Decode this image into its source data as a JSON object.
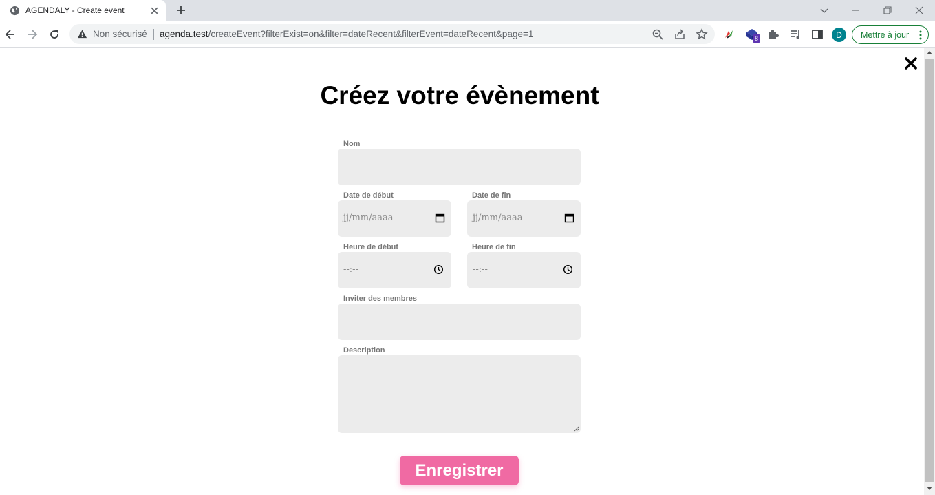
{
  "browser": {
    "tab_title": "AGENDALY - Create event",
    "security_label": "Non sécurisé",
    "url_host": "agenda.test",
    "url_path": "/createEvent?filterExist=on&filter=dateRecent&filterEvent=dateRecent&page=1",
    "extension_badge": "8",
    "profile_initial": "D",
    "update_label": "Mettre à jour"
  },
  "page": {
    "title": "Créez votre évènement",
    "fields": {
      "name": {
        "label": "Nom",
        "value": ""
      },
      "start_date": {
        "label": "Date de début",
        "placeholder": "jj/mm/aaaa"
      },
      "end_date": {
        "label": "Date de fin",
        "placeholder": "jj/mm/aaaa"
      },
      "start_time": {
        "label": "Heure de début",
        "placeholder": "--:--"
      },
      "end_time": {
        "label": "Heure de fin",
        "placeholder": "--:--"
      },
      "invite": {
        "label": "Inviter des membres",
        "value": ""
      },
      "description": {
        "label": "Description",
        "value": ""
      }
    },
    "submit_label": "Enregistrer"
  },
  "colors": {
    "accent": "#f06aa3",
    "field_bg": "#ececec",
    "label": "#777777"
  }
}
